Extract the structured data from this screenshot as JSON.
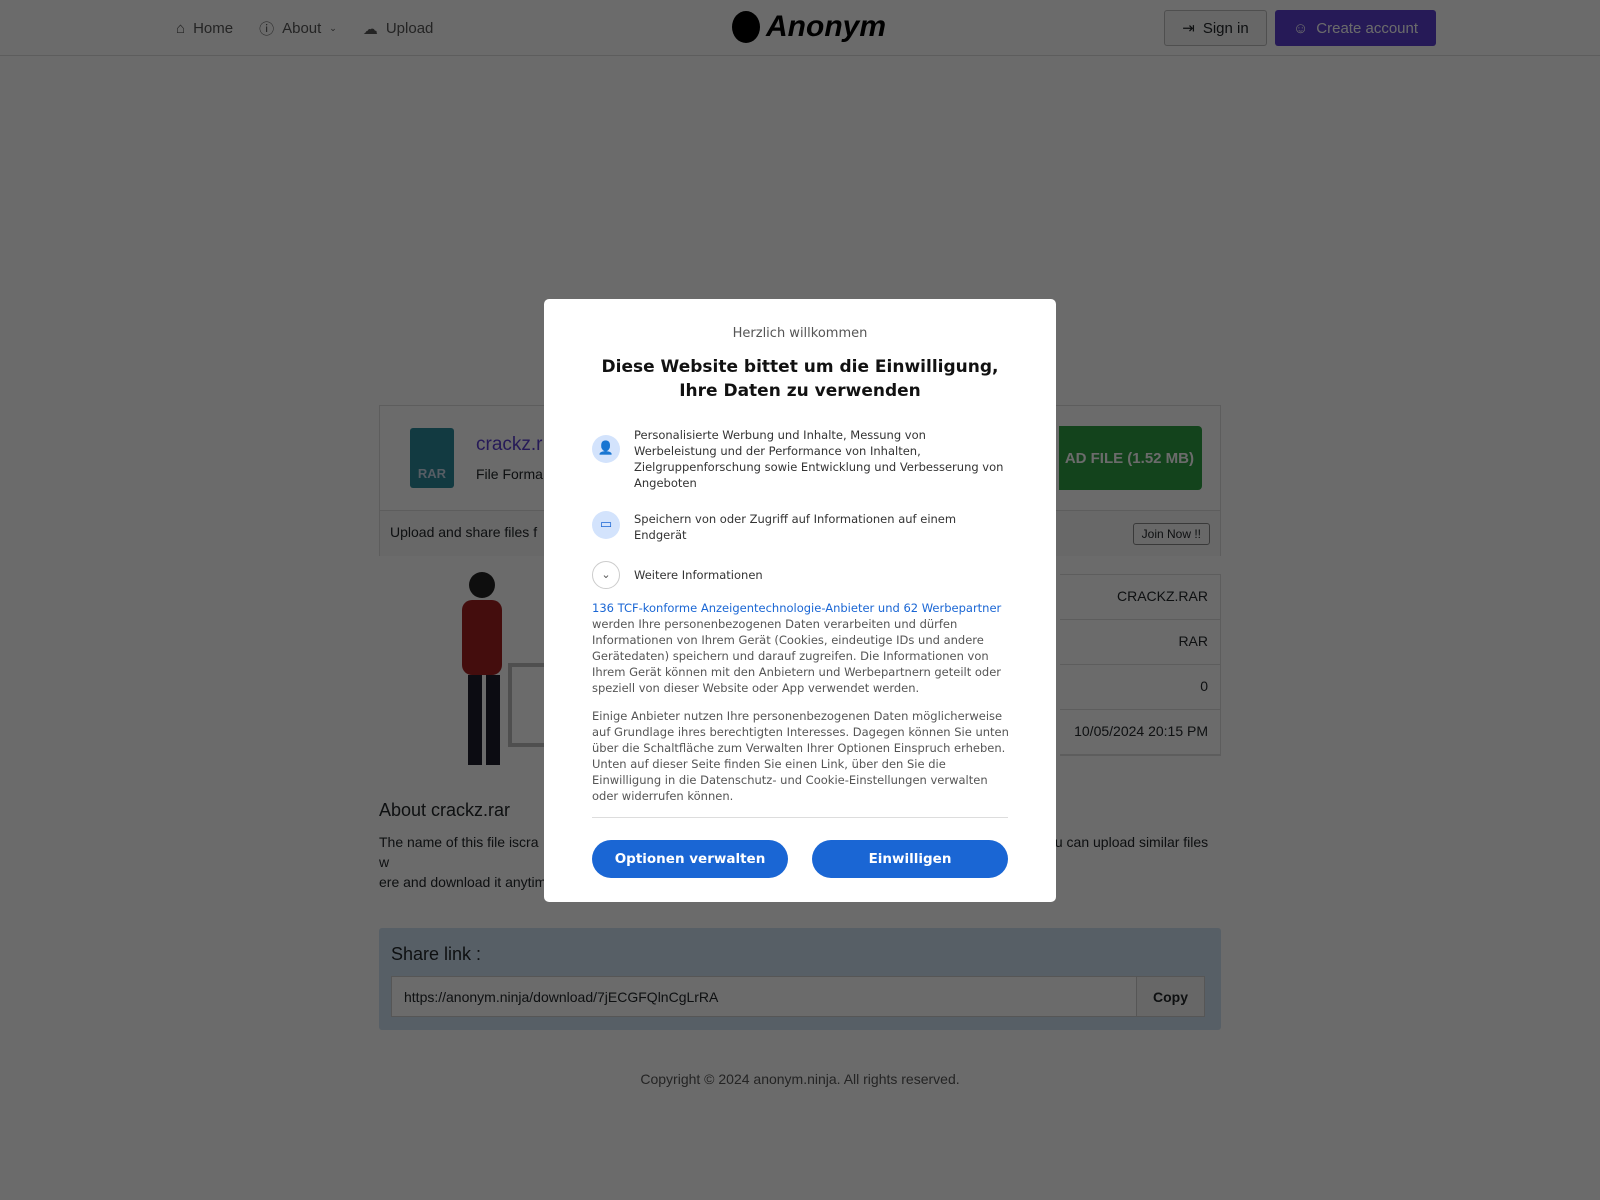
{
  "nav": {
    "home": "Home",
    "about": "About",
    "upload": "Upload",
    "logo": "Anonym",
    "sign_in": "Sign in",
    "create_account": "Create account"
  },
  "file": {
    "name": "crackz.r",
    "format_label": "File Forma",
    "icon_text": "RAR",
    "download": "AD FILE (1.52 MB)",
    "upload_text": "Upload and share files f",
    "join": "Join Now !!"
  },
  "info_rows": [
    "CRACKZ.RAR",
    "RAR",
    "0",
    "10/05/2024 20:15 PM"
  ],
  "about": {
    "title": "About crackz.rar",
    "text": "The name of this file iscra                                                                                                   d and used easily. You can upload similar files w                                                                                               you will be able to manage your files easily.                                                                                                  ere and download it anytime."
  },
  "share": {
    "title": "Share link :",
    "url": "https://anonym.ninja/download/7jECGFQlnCgLrRA",
    "copy": "Copy"
  },
  "footer": "Copyright © 2024 anonym.ninja. All rights reserved.",
  "consent": {
    "welcome": "Herzlich willkommen",
    "title": "Diese Website bittet um die Einwilligung, Ihre Daten zu verwenden",
    "purposes": [
      "Personalisierte Werbung und Inhalte, Messung von Werbeleistung und der Performance von Inhalten, Zielgruppenforschung sowie Entwicklung und Verbesserung von Angeboten",
      "Speichern von oder Zugriff auf Informationen auf einem Endgerät"
    ],
    "more": "Weitere Informationen",
    "partners_link": "136 TCF-konforme Anzeigentechnologie-Anbieter und 62 Werbepartner",
    "para1": "werden Ihre personenbezogenen Daten verarbeiten und dürfen Informationen von Ihrem Gerät (Cookies, eindeutige IDs und andere Gerätedaten) speichern und darauf zugreifen. Die Informationen von Ihrem Gerät können mit den Anbietern und Werbepartnern geteilt oder speziell von dieser Website oder App verwendet werden.",
    "para2": "Einige Anbieter nutzen Ihre personenbezogenen Daten möglicherweise auf Grundlage ihres berechtigten Interesses. Dagegen können Sie unten über die Schaltfläche zum Verwalten Ihrer Optionen Einspruch erheben. Unten auf dieser Seite finden Sie einen Link, über den Sie die Einwilligung in die Datenschutz- und Cookie-Einstellungen verwalten oder widerrufen können.",
    "manage": "Optionen verwalten",
    "accept": "Einwilligen"
  },
  "colors": {
    "brand": "#5a3fd0",
    "download": "#2ea043",
    "consent_button": "#1a66d4"
  }
}
